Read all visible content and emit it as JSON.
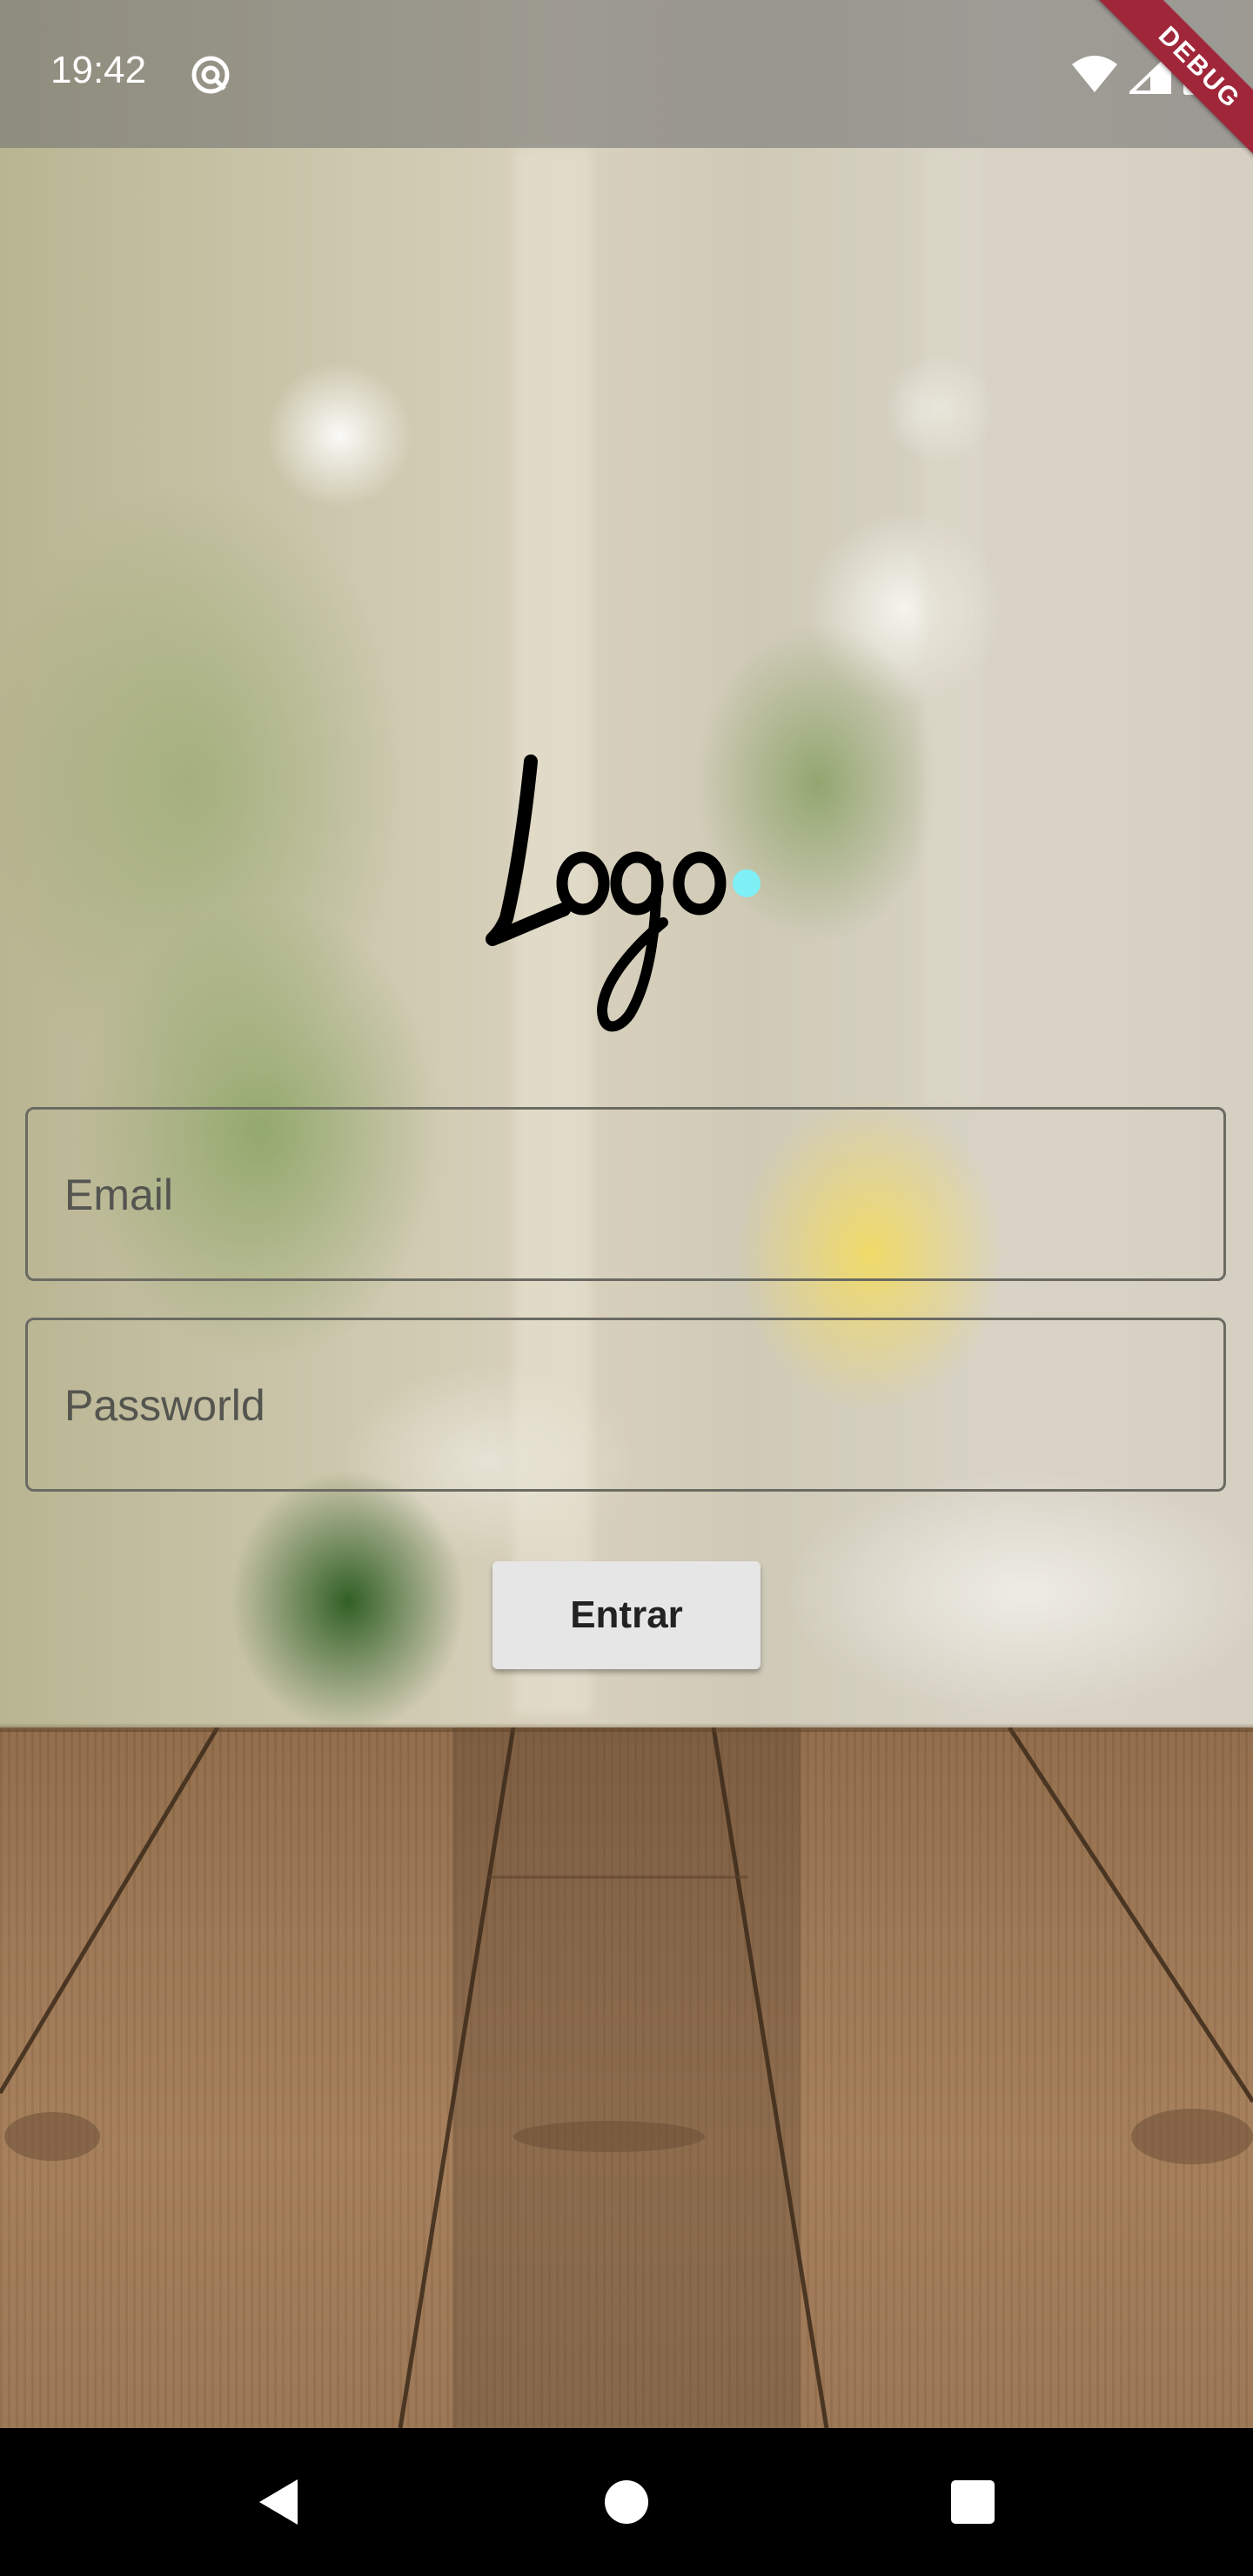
{
  "status_bar": {
    "time": "19:42",
    "icons": [
      "at-sign-icon",
      "wifi-icon",
      "signal-icon",
      "battery-icon"
    ]
  },
  "debug_banner": {
    "label": "DEBUG"
  },
  "logo": {
    "text": "Logo",
    "dot_color": "#7ff0f5"
  },
  "form": {
    "email": {
      "placeholder": "Email",
      "value": ""
    },
    "password": {
      "placeholder": "Passworld",
      "value": ""
    },
    "submit_label": "Entrar"
  },
  "nav_bar": {
    "icons": [
      "back-icon",
      "home-icon",
      "recents-icon"
    ]
  },
  "colors": {
    "banner": "#a0263a",
    "button_bg": "#e6e6e6",
    "field_border": "#6b6b63"
  }
}
